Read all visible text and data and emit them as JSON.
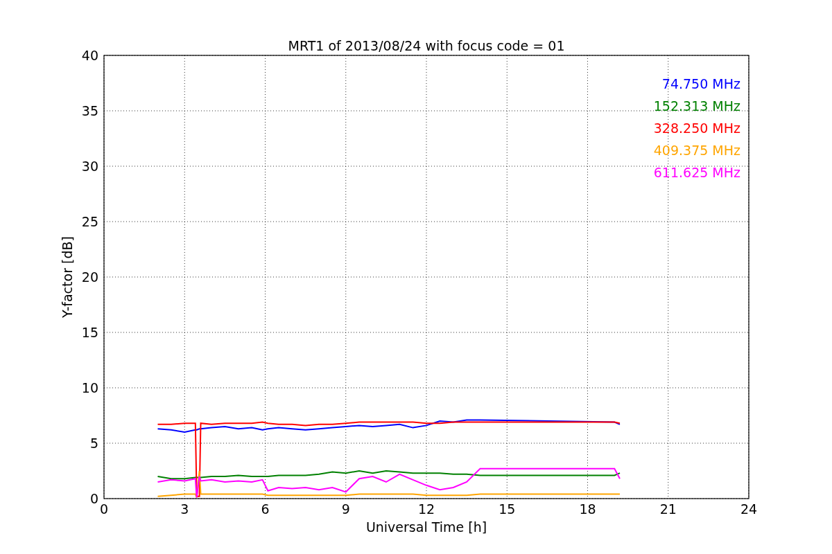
{
  "figure": {
    "chart_data": {
      "type": "line",
      "title": "MRT1 of 2013/08/24 with focus code = 01",
      "xlabel": "Universal Time [h]",
      "ylabel": "Y-factor [dB]",
      "x": [
        2,
        2.5,
        3,
        3.4,
        3.45,
        3.55,
        3.6,
        4,
        4.5,
        5,
        5.5,
        5.9,
        6.1,
        6.5,
        7,
        7.5,
        8,
        8.5,
        9,
        9.5,
        10,
        10.5,
        11,
        11.5,
        12,
        12.5,
        13,
        13.5,
        14,
        19,
        19.2
      ],
      "series": [
        {
          "name": "74.750 MHz",
          "color": "#0000ff",
          "values": [
            6.3,
            6.2,
            6.0,
            6.2,
            6.2,
            6.3,
            6.3,
            6.4,
            6.5,
            6.3,
            6.4,
            6.2,
            6.3,
            6.4,
            6.3,
            6.2,
            6.3,
            6.4,
            6.5,
            6.6,
            6.5,
            6.6,
            6.7,
            6.4,
            6.6,
            7.0,
            6.9,
            7.1,
            7.1,
            6.9,
            6.7
          ]
        },
        {
          "name": "152.313 MHz",
          "color": "#008000",
          "values": [
            2.0,
            1.8,
            1.8,
            1.9,
            1.9,
            1.9,
            1.9,
            2.0,
            2.0,
            2.1,
            2.0,
            2.0,
            2.0,
            2.1,
            2.1,
            2.1,
            2.2,
            2.4,
            2.3,
            2.5,
            2.3,
            2.5,
            2.4,
            2.3,
            2.3,
            2.3,
            2.2,
            2.2,
            2.1,
            2.1,
            2.3
          ]
        },
        {
          "name": "328.250 MHz",
          "color": "#ff0000",
          "values": [
            6.7,
            6.7,
            6.8,
            6.8,
            0.2,
            0.2,
            6.8,
            6.7,
            6.8,
            6.8,
            6.8,
            6.9,
            6.8,
            6.7,
            6.7,
            6.6,
            6.7,
            6.7,
            6.8,
            6.9,
            6.9,
            6.9,
            6.9,
            6.9,
            6.8,
            6.8,
            6.9,
            6.9,
            6.9,
            6.9,
            6.8
          ]
        },
        {
          "name": "409.375 MHz",
          "color": "#ffa500",
          "values": [
            0.2,
            0.3,
            0.4,
            0.4,
            0.1,
            2.5,
            0.4,
            0.4,
            0.4,
            0.4,
            0.4,
            0.4,
            0.3,
            0.3,
            0.3,
            0.3,
            0.3,
            0.3,
            0.3,
            0.4,
            0.4,
            0.4,
            0.4,
            0.4,
            0.3,
            0.3,
            0.3,
            0.3,
            0.4,
            0.4,
            0.4
          ]
        },
        {
          "name": "611.625 MHz",
          "color": "#ff00ff",
          "values": [
            1.5,
            1.7,
            1.6,
            1.8,
            0.1,
            2.0,
            1.6,
            1.7,
            1.5,
            1.6,
            1.5,
            1.7,
            0.7,
            1.0,
            0.9,
            1.0,
            0.8,
            1.0,
            0.6,
            1.8,
            2.0,
            1.5,
            2.2,
            1.7,
            1.2,
            0.8,
            1.0,
            1.5,
            2.7,
            2.7,
            1.8
          ]
        }
      ],
      "grid": true,
      "xlim": [
        0,
        24
      ],
      "ylim": [
        0,
        40
      ],
      "xticks": [
        0,
        3,
        6,
        9,
        12,
        15,
        18,
        21,
        24
      ],
      "yticks": [
        0,
        5,
        10,
        15,
        20,
        25,
        30,
        35,
        40
      ]
    }
  }
}
